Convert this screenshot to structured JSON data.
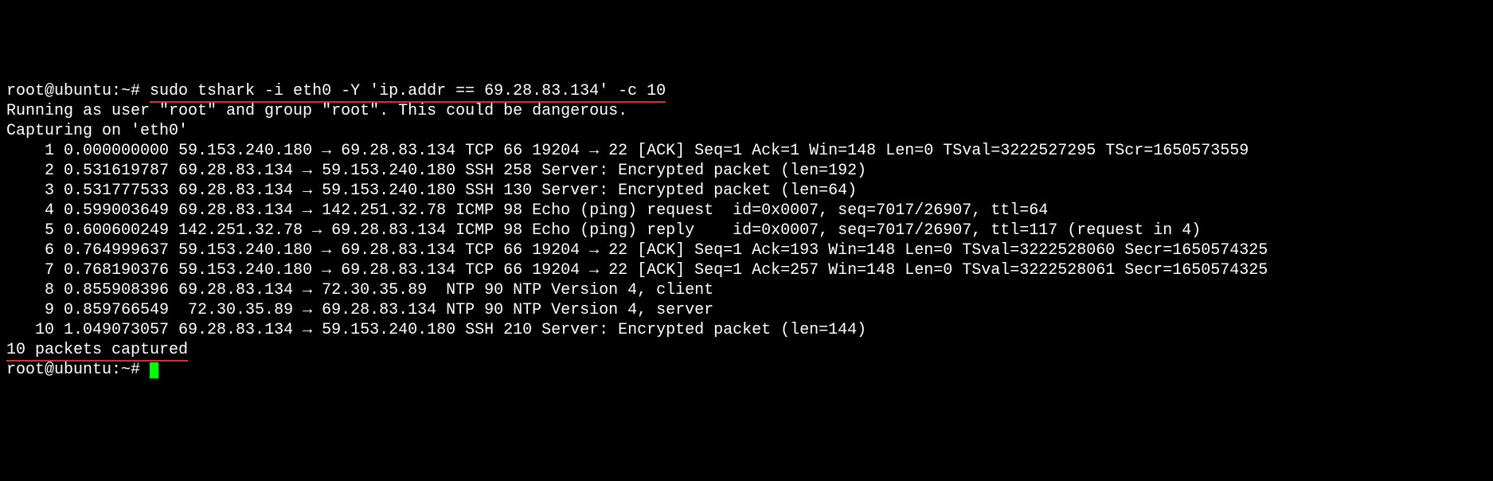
{
  "prompt1_prefix": "root@ubuntu:~# ",
  "command": "sudo tshark -i eth0 -Y 'ip.addr == 69.28.83.134' -c 10",
  "warn_line": "Running as user \"root\" and group \"root\". This could be dangerous.",
  "capturing_line": "Capturing on 'eth0'",
  "packets": [
    "    1 0.000000000 59.153.240.180 → 69.28.83.134 TCP 66 19204 → 22 [ACK] Seq=1 Ack=1 Win=148 Len=0 TSval=3222527295 TScr=1650573559",
    "    2 0.531619787 69.28.83.134 → 59.153.240.180 SSH 258 Server: Encrypted packet (len=192)",
    "    3 0.531777533 69.28.83.134 → 59.153.240.180 SSH 130 Server: Encrypted packet (len=64)",
    "    4 0.599003649 69.28.83.134 → 142.251.32.78 ICMP 98 Echo (ping) request  id=0x0007, seq=7017/26907, ttl=64",
    "    5 0.600600249 142.251.32.78 → 69.28.83.134 ICMP 98 Echo (ping) reply    id=0x0007, seq=7017/26907, ttl=117 (request in 4)",
    "    6 0.764999637 59.153.240.180 → 69.28.83.134 TCP 66 19204 → 22 [ACK] Seq=1 Ack=193 Win=148 Len=0 TSval=3222528060 Secr=1650574325",
    "    7 0.768190376 59.153.240.180 → 69.28.83.134 TCP 66 19204 → 22 [ACK] Seq=1 Ack=257 Win=148 Len=0 TSval=3222528061 Secr=1650574325",
    "    8 0.855908396 69.28.83.134 → 72.30.35.89  NTP 90 NTP Version 4, client",
    "    9 0.859766549  72.30.35.89 → 69.28.83.134 NTP 90 NTP Version 4, server",
    "   10 1.049073057 69.28.83.134 → 59.153.240.180 SSH 210 Server: Encrypted packet (len=144)"
  ],
  "summary": "10 packets captured",
  "prompt2": "root@ubuntu:~# "
}
